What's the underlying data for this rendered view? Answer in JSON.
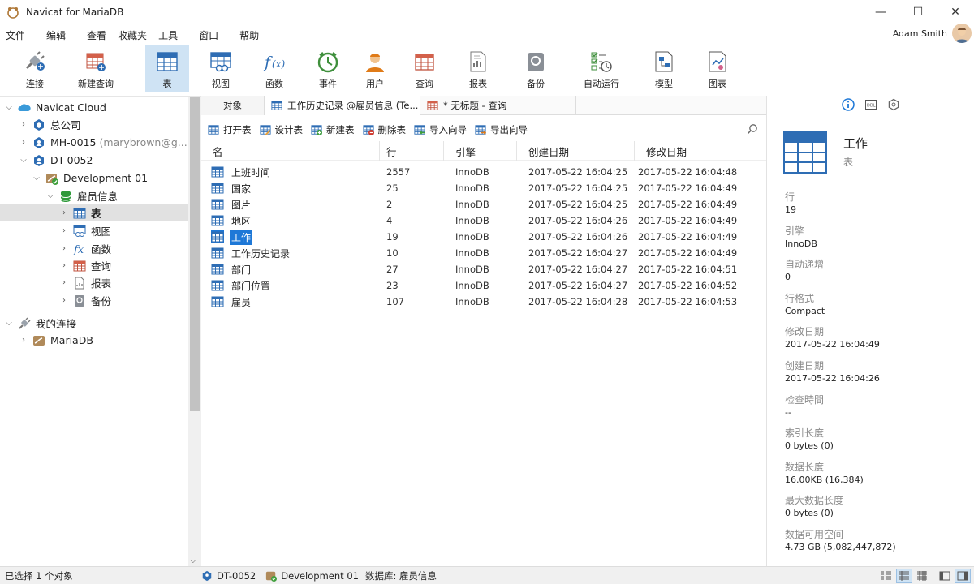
{
  "window": {
    "title": "Navicat for MariaDB",
    "minimize": "—",
    "maximize": "☐",
    "close": "✕"
  },
  "menu": [
    "文件",
    "编辑",
    "查看",
    "收藏夹",
    "工具",
    "窗口",
    "帮助"
  ],
  "user": {
    "name": "Adam Smith"
  },
  "toolbar": {
    "connect": "连接",
    "new_query": "新建查询",
    "table": "表",
    "view": "视图",
    "function": "函数",
    "event": "事件",
    "user": "用户",
    "query": "查询",
    "report": "报表",
    "backup": "备份",
    "automation": "自动运行",
    "model": "模型",
    "chart": "图表",
    "active": "表"
  },
  "tree": {
    "items": [
      {
        "label": "Navicat Cloud"
      },
      {
        "label": "总公司"
      },
      {
        "label": "MH-0015",
        "extra": "(marybrown@g..."
      },
      {
        "label": "DT-0052"
      },
      {
        "label": "Development 01"
      },
      {
        "label": "雇员信息"
      },
      {
        "label": "表"
      },
      {
        "label": "视图"
      },
      {
        "label": "函数"
      },
      {
        "label": "查询"
      },
      {
        "label": "报表"
      },
      {
        "label": "备份"
      },
      {
        "label": "我的连接"
      },
      {
        "label": "MariaDB"
      }
    ]
  },
  "tabs": [
    {
      "label": "对象"
    },
    {
      "label": "工作历史记录 @雇员信息 (Te..."
    },
    {
      "label": "* 无标题 - 查询"
    }
  ],
  "objbar": {
    "open": "打开表",
    "design": "设计表",
    "new": "新建表",
    "delete": "删除表",
    "import": "导入向导",
    "export": "导出向导"
  },
  "grid": {
    "columns": [
      "名",
      "行",
      "引擎",
      "创建日期",
      "修改日期"
    ],
    "rows": [
      {
        "name": "上班时间",
        "rows": "2557",
        "engine": "InnoDB",
        "created": "2017-05-22 16:04:25",
        "modified": "2017-05-22 16:04:48"
      },
      {
        "name": "国家",
        "rows": "25",
        "engine": "InnoDB",
        "created": "2017-05-22 16:04:25",
        "modified": "2017-05-22 16:04:49"
      },
      {
        "name": "图片",
        "rows": "2",
        "engine": "InnoDB",
        "created": "2017-05-22 16:04:25",
        "modified": "2017-05-22 16:04:49"
      },
      {
        "name": "地区",
        "rows": "4",
        "engine": "InnoDB",
        "created": "2017-05-22 16:04:26",
        "modified": "2017-05-22 16:04:49"
      },
      {
        "name": "工作",
        "rows": "19",
        "engine": "InnoDB",
        "created": "2017-05-22 16:04:26",
        "modified": "2017-05-22 16:04:49"
      },
      {
        "name": "工作历史记录",
        "rows": "10",
        "engine": "InnoDB",
        "created": "2017-05-22 16:04:27",
        "modified": "2017-05-22 16:04:49"
      },
      {
        "name": "部门",
        "rows": "27",
        "engine": "InnoDB",
        "created": "2017-05-22 16:04:27",
        "modified": "2017-05-22 16:04:51"
      },
      {
        "name": "部门位置",
        "rows": "23",
        "engine": "InnoDB",
        "created": "2017-05-22 16:04:27",
        "modified": "2017-05-22 16:04:52"
      },
      {
        "name": "雇员",
        "rows": "107",
        "engine": "InnoDB",
        "created": "2017-05-22 16:04:28",
        "modified": "2017-05-22 16:04:53"
      }
    ],
    "selected": "工作"
  },
  "info": {
    "name": "工作",
    "type": "表",
    "props": [
      {
        "key": "行",
        "value": "19"
      },
      {
        "key": "引擎",
        "value": "InnoDB"
      },
      {
        "key": "自动递增",
        "value": "0"
      },
      {
        "key": "行格式",
        "value": "Compact"
      },
      {
        "key": "修改日期",
        "value": "2017-05-22 16:04:49"
      },
      {
        "key": "创建日期",
        "value": "2017-05-22 16:04:26"
      },
      {
        "key": "检查時間",
        "value": "--"
      },
      {
        "key": "索引长度",
        "value": "0 bytes (0)"
      },
      {
        "key": "数据长度",
        "value": "16.00KB (16,384)"
      },
      {
        "key": "最大数据长度",
        "value": "0 bytes (0)"
      },
      {
        "key": "数据可用空间",
        "value": "4.73 GB (5,082,447,872)"
      }
    ]
  },
  "status": {
    "selected": "已选择 1 个对象",
    "connection": "DT-0052",
    "database_conn": "Development 01",
    "database": "数据库: 雇员信息"
  },
  "colors": {
    "accent": "#1e78d7",
    "active_tool": "#cfe3f4",
    "table_icon": "#2e6db4"
  }
}
